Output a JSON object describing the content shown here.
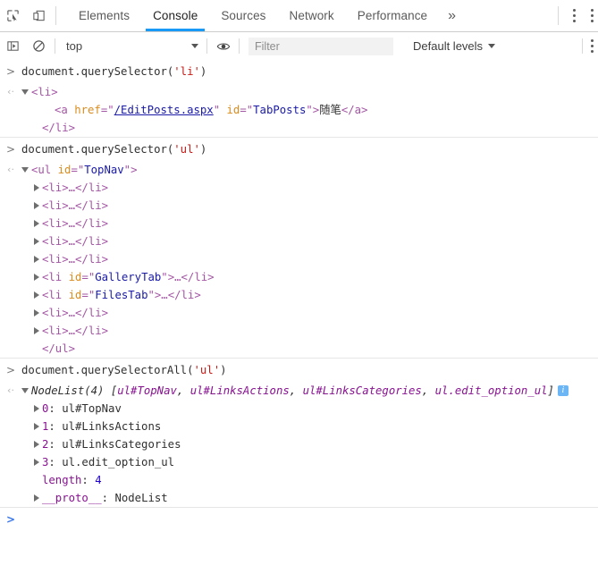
{
  "tabbar": {
    "icons": [
      {
        "name": "inspect-element-icon",
        "title": "Inspect element"
      },
      {
        "name": "device-toolbar-icon",
        "title": "Toggle device toolbar"
      }
    ],
    "tabs": [
      {
        "label": "Elements",
        "active": false
      },
      {
        "label": "Console",
        "active": true
      },
      {
        "label": "Sources",
        "active": false
      },
      {
        "label": "Network",
        "active": false
      },
      {
        "label": "Performance",
        "active": false
      }
    ],
    "more_tabs_label": "»",
    "kebab_label": "⋮"
  },
  "filterbar": {
    "sidebar_toggle_name": "console-sidebar-icon",
    "clear_console_name": "clear-console-icon",
    "context": {
      "value": "top",
      "caret": "▼"
    },
    "eye_icon_name": "live-expression-eye-icon",
    "filter": {
      "value": "",
      "placeholder": "Filter"
    },
    "levels": {
      "label": "Default levels",
      "caret": "▼"
    }
  },
  "console": {
    "input_arrow": ">",
    "output_arrow": "‹·",
    "entries": [
      {
        "type": "command",
        "text_parts": [
          {
            "t": "document.querySelector(",
            "c": "plain"
          },
          {
            "t": "'li'",
            "c": "str"
          },
          {
            "t": ")",
            "c": "plain"
          }
        ],
        "result_lines": [
          {
            "indent": 0,
            "tri": "open",
            "parts": [
              {
                "t": "<li>",
                "c": "tag"
              }
            ]
          },
          {
            "indent": 2,
            "tri": "none",
            "parts": [
              {
                "t": "<a ",
                "c": "tag"
              },
              {
                "t": "href",
                "c": "attr"
              },
              {
                "t": "=\"",
                "c": "tag"
              },
              {
                "t": "/EditPosts.aspx",
                "c": "link"
              },
              {
                "t": "\" ",
                "c": "tag"
              },
              {
                "t": "id",
                "c": "attr"
              },
              {
                "t": "=\"",
                "c": "tag"
              },
              {
                "t": "TabPosts",
                "c": "val"
              },
              {
                "t": "\">",
                "c": "tag"
              },
              {
                "t": "随笔",
                "c": "cjk"
              },
              {
                "t": "</a>",
                "c": "tag"
              }
            ]
          },
          {
            "indent": 1,
            "tri": "none",
            "parts": [
              {
                "t": "</li>",
                "c": "tag"
              }
            ]
          }
        ]
      },
      {
        "type": "command",
        "text_parts": [
          {
            "t": "document.querySelector(",
            "c": "plain"
          },
          {
            "t": "'ul'",
            "c": "str"
          },
          {
            "t": ")",
            "c": "plain"
          }
        ],
        "result_lines": [
          {
            "indent": 0,
            "tri": "open",
            "parts": [
              {
                "t": "<ul ",
                "c": "tag"
              },
              {
                "t": "id",
                "c": "attr"
              },
              {
                "t": "=\"",
                "c": "tag"
              },
              {
                "t": "TopNav",
                "c": "val"
              },
              {
                "t": "\">",
                "c": "tag"
              }
            ]
          },
          {
            "indent": 1,
            "tri": "closed",
            "parts": [
              {
                "t": "<li>",
                "c": "tag"
              },
              {
                "t": "…",
                "c": "ellip"
              },
              {
                "t": "</li>",
                "c": "tag"
              }
            ]
          },
          {
            "indent": 1,
            "tri": "closed",
            "parts": [
              {
                "t": "<li>",
                "c": "tag"
              },
              {
                "t": "…",
                "c": "ellip"
              },
              {
                "t": "</li>",
                "c": "tag"
              }
            ]
          },
          {
            "indent": 1,
            "tri": "closed",
            "parts": [
              {
                "t": "<li>",
                "c": "tag"
              },
              {
                "t": "…",
                "c": "ellip"
              },
              {
                "t": "</li>",
                "c": "tag"
              }
            ]
          },
          {
            "indent": 1,
            "tri": "closed",
            "parts": [
              {
                "t": "<li>",
                "c": "tag"
              },
              {
                "t": "…",
                "c": "ellip"
              },
              {
                "t": "</li>",
                "c": "tag"
              }
            ]
          },
          {
            "indent": 1,
            "tri": "closed",
            "parts": [
              {
                "t": "<li>",
                "c": "tag"
              },
              {
                "t": "…",
                "c": "ellip"
              },
              {
                "t": "</li>",
                "c": "tag"
              }
            ]
          },
          {
            "indent": 1,
            "tri": "closed",
            "parts": [
              {
                "t": "<li ",
                "c": "tag"
              },
              {
                "t": "id",
                "c": "attr"
              },
              {
                "t": "=\"",
                "c": "tag"
              },
              {
                "t": "GalleryTab",
                "c": "val"
              },
              {
                "t": "\">",
                "c": "tag"
              },
              {
                "t": "…",
                "c": "ellip"
              },
              {
                "t": "</li>",
                "c": "tag"
              }
            ]
          },
          {
            "indent": 1,
            "tri": "closed",
            "parts": [
              {
                "t": "<li ",
                "c": "tag"
              },
              {
                "t": "id",
                "c": "attr"
              },
              {
                "t": "=\"",
                "c": "tag"
              },
              {
                "t": "FilesTab",
                "c": "val"
              },
              {
                "t": "\">",
                "c": "tag"
              },
              {
                "t": "…",
                "c": "ellip"
              },
              {
                "t": "</li>",
                "c": "tag"
              }
            ]
          },
          {
            "indent": 1,
            "tri": "closed",
            "parts": [
              {
                "t": "<li>",
                "c": "tag"
              },
              {
                "t": "…",
                "c": "ellip"
              },
              {
                "t": "</li>",
                "c": "tag"
              }
            ]
          },
          {
            "indent": 1,
            "tri": "closed",
            "parts": [
              {
                "t": "<li>",
                "c": "tag"
              },
              {
                "t": "…",
                "c": "ellip"
              },
              {
                "t": "</li>",
                "c": "tag"
              }
            ]
          },
          {
            "indent": 1,
            "tri": "none",
            "parts": [
              {
                "t": "</ul>",
                "c": "tag"
              }
            ]
          }
        ]
      },
      {
        "type": "command",
        "text_parts": [
          {
            "t": "document.querySelectorAll(",
            "c": "plain"
          },
          {
            "t": "'ul'",
            "c": "str"
          },
          {
            "t": ")",
            "c": "plain"
          }
        ],
        "result_lines": [
          {
            "indent": 0,
            "tri": "open-nodelist",
            "parts": [
              {
                "t": "NodeList(4)",
                "c": "nodelist"
              },
              {
                "t": " [",
                "c": "nodelist"
              },
              {
                "t": "ul#TopNav",
                "c": "node"
              },
              {
                "t": ", ",
                "c": "nodelist"
              },
              {
                "t": "ul#LinksActions",
                "c": "node"
              },
              {
                "t": ", ",
                "c": "nodelist"
              },
              {
                "t": "ul#LinksCategories",
                "c": "node"
              },
              {
                "t": ", ",
                "c": "nodelist"
              },
              {
                "t": "ul.edit_option_ul",
                "c": "node"
              },
              {
                "t": "]",
                "c": "nodelist"
              },
              {
                "t": "INFOICON",
                "c": "info"
              }
            ]
          },
          {
            "indent": 1,
            "tri": "closed",
            "parts": [
              {
                "t": "0",
                "c": "idx"
              },
              {
                "t": ": ",
                "c": "plain"
              },
              {
                "t": "ul#TopNav",
                "c": "node-plain"
              }
            ]
          },
          {
            "indent": 1,
            "tri": "closed",
            "parts": [
              {
                "t": "1",
                "c": "idx"
              },
              {
                "t": ": ",
                "c": "plain"
              },
              {
                "t": "ul#LinksActions",
                "c": "node-plain"
              }
            ]
          },
          {
            "indent": 1,
            "tri": "closed",
            "parts": [
              {
                "t": "2",
                "c": "idx"
              },
              {
                "t": ": ",
                "c": "plain"
              },
              {
                "t": "ul#LinksCategories",
                "c": "node-plain"
              }
            ]
          },
          {
            "indent": 1,
            "tri": "closed",
            "parts": [
              {
                "t": "3",
                "c": "idx"
              },
              {
                "t": ": ",
                "c": "plain"
              },
              {
                "t": "ul.edit_option_ul",
                "c": "node-plain"
              }
            ]
          },
          {
            "indent": 1,
            "tri": "none",
            "parts": [
              {
                "t": "length",
                "c": "prop"
              },
              {
                "t": ": ",
                "c": "plain"
              },
              {
                "t": "4",
                "c": "num"
              }
            ]
          },
          {
            "indent": 1,
            "tri": "closed",
            "parts": [
              {
                "t": "__proto__",
                "c": "proto"
              },
              {
                "t": ": ",
                "c": "plain"
              },
              {
                "t": "NodeList",
                "c": "protoval"
              }
            ]
          }
        ]
      }
    ]
  },
  "colors": {
    "accent_blue": "#1a9af7",
    "prompt_blue": "#3b78e7",
    "string_red": "#c41a16",
    "tag_purple": "#a356a3",
    "attr_orange": "#d98c1e",
    "value_blue": "#1a1aa6",
    "node_magenta": "#881391"
  }
}
